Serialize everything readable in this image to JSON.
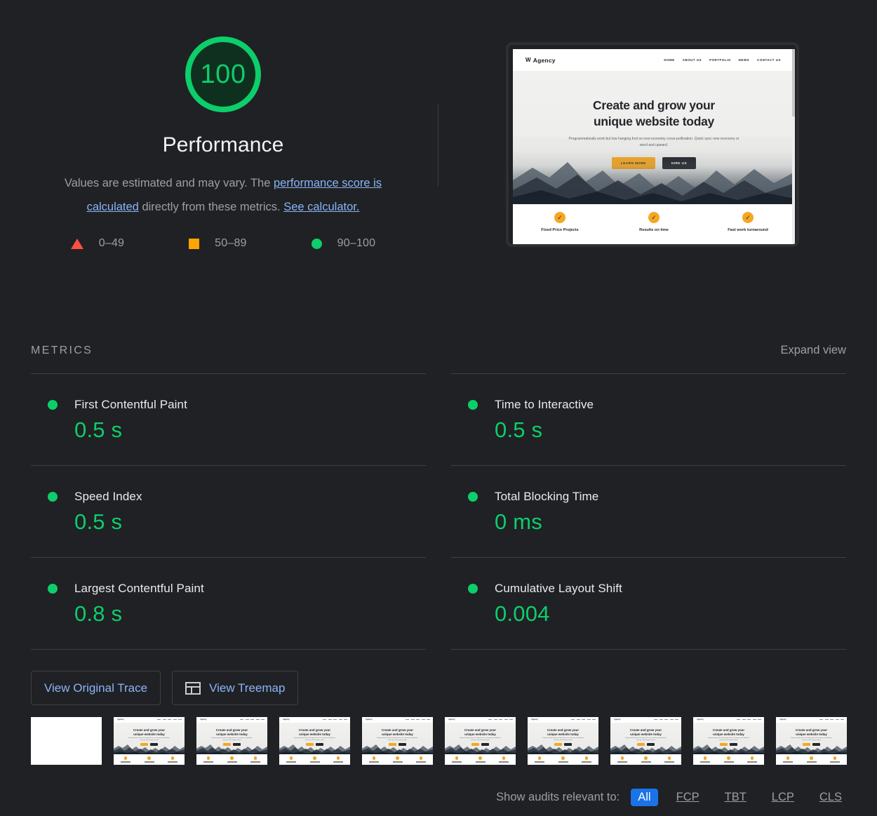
{
  "score": {
    "value": "100",
    "category_title": "Performance",
    "gauge_color": "#0cce6b",
    "description_prefix": "Values are estimated and may vary. The ",
    "link_score_calc": "performance score is calculated",
    "description_middle": " directly from these metrics. ",
    "link_calculator": "See calculator."
  },
  "legend": [
    {
      "icon": "triangle-icon",
      "range": "0–49",
      "color": "#ff4e42"
    },
    {
      "icon": "square-icon",
      "range": "50–89",
      "color": "#ffa400"
    },
    {
      "icon": "circle-icon",
      "range": "90–100",
      "color": "#0cce6b"
    }
  ],
  "preview": {
    "logo": "Agency",
    "logo_mark": "W",
    "nav": [
      "HOME",
      "ABOUT US",
      "PORTFOLIO",
      "NEWS",
      "CONTACT US"
    ],
    "headline_line1": "Create and grow your",
    "headline_line2": "unique website today",
    "subtext": "Programmatically work but low hanging fruit so new economy cross-pollination. Quick sync new economy or word and upward.",
    "cta_primary": "LEARN MORE",
    "cta_secondary": "HIRE US",
    "features": [
      "Fixed Price Projects",
      "Results on time",
      "Fast work turnaround"
    ]
  },
  "metrics_section": {
    "title": "METRICS",
    "expand_view": "Expand view",
    "items": [
      {
        "name": "First Contentful Paint",
        "value": "0.5 s",
        "status": "pass",
        "column": "left"
      },
      {
        "name": "Speed Index",
        "value": "0.5 s",
        "status": "pass",
        "column": "left"
      },
      {
        "name": "Largest Contentful Paint",
        "value": "0.8 s",
        "status": "pass",
        "column": "left"
      },
      {
        "name": "Time to Interactive",
        "value": "0.5 s",
        "status": "pass",
        "column": "right"
      },
      {
        "name": "Total Blocking Time",
        "value": "0 ms",
        "status": "pass",
        "column": "right"
      },
      {
        "name": "Cumulative Layout Shift",
        "value": "0.004",
        "status": "pass",
        "column": "right"
      }
    ]
  },
  "actions": {
    "view_original_trace": "View Original Trace",
    "view_treemap": "View Treemap"
  },
  "filmstrip": {
    "frame_count": 10,
    "first_frame_blank": true
  },
  "audit_filter": {
    "label": "Show audits relevant to:",
    "options": [
      "All",
      "FCP",
      "TBT",
      "LCP",
      "CLS"
    ],
    "selected": "All",
    "active_color": "#1a73e8"
  }
}
